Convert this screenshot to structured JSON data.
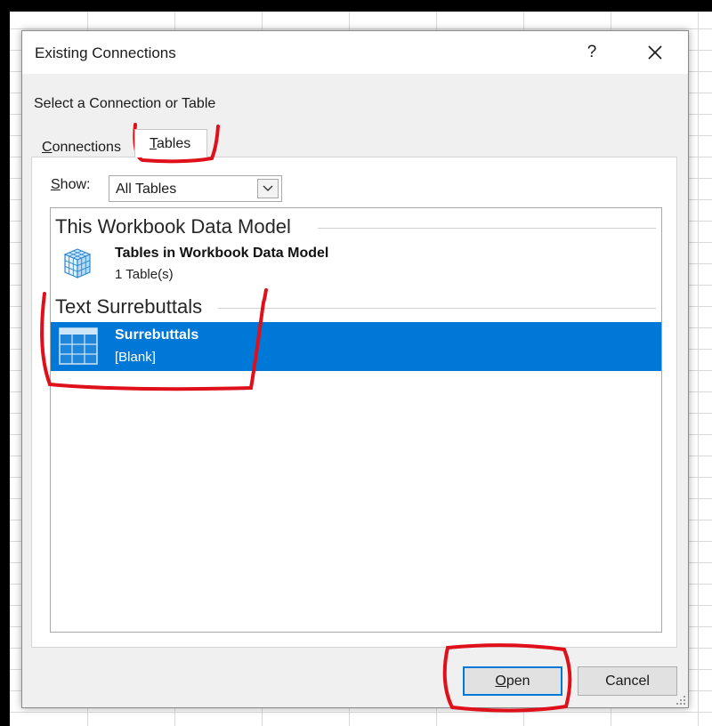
{
  "dialog": {
    "title": "Existing Connections",
    "help_label": "?",
    "subtitle": "Select a Connection or Table"
  },
  "tabs": [
    {
      "label_first": "C",
      "label_rest": "onnections",
      "selected": false
    },
    {
      "label_first": "T",
      "label_rest": "ables",
      "selected": true
    }
  ],
  "show": {
    "label_first": "S",
    "label_rest": "how:",
    "value": "All Tables"
  },
  "groups": [
    {
      "header": "This Workbook Data Model",
      "items": [
        {
          "title": "Tables in Workbook Data Model",
          "subtitle": "1 Table(s)",
          "icon": "data-model-cube-icon",
          "selected": false
        }
      ]
    },
    {
      "header": "Text Surrebuttals",
      "items": [
        {
          "title": "Surrebuttals",
          "subtitle": "[Blank]",
          "icon": "table-icon",
          "selected": true
        }
      ]
    }
  ],
  "buttons": {
    "open_first": "O",
    "open_rest": "pen",
    "cancel": "Cancel"
  },
  "colors": {
    "selection": "#0078d7",
    "annotation": "#e0101a"
  }
}
